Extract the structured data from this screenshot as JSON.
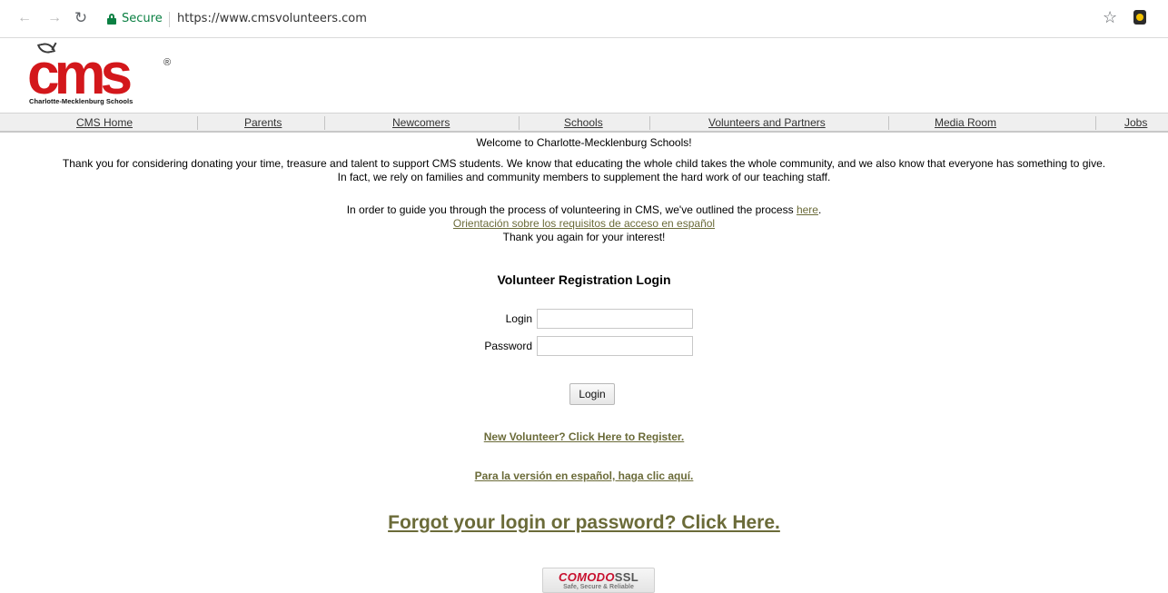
{
  "browser": {
    "back_icon": "arrow-left-icon",
    "forward_icon": "arrow-right-icon",
    "reload_icon": "reload-icon",
    "secure_label": "Secure",
    "url": "https://www.cmsvolunteers.com",
    "bookmark_icon": "star-icon",
    "extension_icon": "extension-icon",
    "secure_color": "#0b8043"
  },
  "logo": {
    "mark": "cms",
    "registered": "®",
    "subtitle": "Charlotte-Mecklenburg Schools",
    "brand_color": "#d3171b"
  },
  "nav": {
    "items": [
      {
        "label": "CMS Home"
      },
      {
        "label": "Parents"
      },
      {
        "label": "Newcomers"
      },
      {
        "label": "Schools"
      },
      {
        "label": "Volunteers and Partners"
      },
      {
        "label": "Media Room"
      },
      {
        "label": "Jobs"
      }
    ]
  },
  "intro": {
    "welcome": "Welcome to Charlotte-Mecklenburg Schools!",
    "thanks_line1": "Thank you for considering donating your time, treasure and talent to support CMS students. We know that educating the whole child takes the whole community, and we also know that everyone has something to give.",
    "thanks_line2": "In fact, we rely on families and community members to supplement the hard work of our teaching staff.",
    "guide_text": "In order to guide you through the process of volunteering in CMS, we've outlined the process ",
    "guide_link": "here",
    "guide_end": ".",
    "spanish_guide_link": "Orientación sobre los requisitos de acceso en español",
    "thanks_again": "Thank you again for your interest!"
  },
  "login": {
    "title": "Volunteer Registration Login",
    "login_label": "Login",
    "login_value": "",
    "password_label": "Password",
    "password_value": "",
    "button_label": "Login"
  },
  "links": {
    "register": "New Volunteer? Click Here to Register.",
    "espanol": "Para la versión en español, haga clic aquí.",
    "forgot": "Forgot your login or password? Click Here.",
    "link_color": "#6b6b39"
  },
  "badge": {
    "brand": "COMODO",
    "product": "SSL",
    "tagline": "Safe, Secure & Reliable"
  }
}
